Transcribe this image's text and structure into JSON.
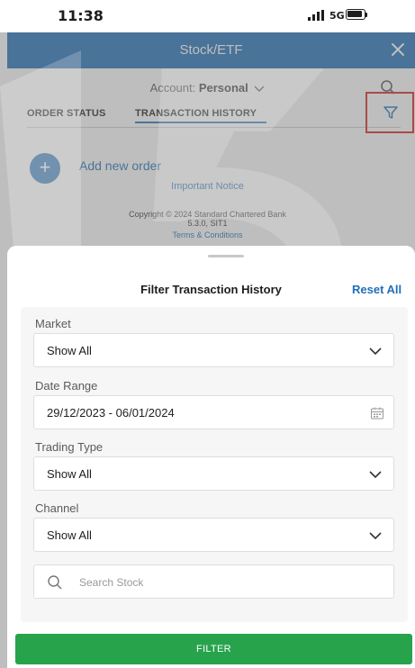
{
  "status_bar": {
    "time": "11:38",
    "network": "5G"
  },
  "header": {
    "title": "Stock/ETF"
  },
  "account": {
    "label": "Account:",
    "value": "Personal"
  },
  "tabs": [
    {
      "label": "ORDER STATUS"
    },
    {
      "label": "TRANSACTION HISTORY"
    }
  ],
  "background": {
    "add_order": "Add new order",
    "notice": "Important Notice",
    "copyright_line1": "Copyright © 2024 Standard Chartered Bank",
    "copyright_line2": "5.3.0, SIT1",
    "terms": "Terms & Conditions",
    "watermark": "15"
  },
  "sheet": {
    "title": "Filter Transaction History",
    "reset_label": "Reset All",
    "market": {
      "label": "Market",
      "value": "Show All"
    },
    "date_range": {
      "label": "Date Range",
      "value": "29/12/2023 - 06/01/2024"
    },
    "trading_type": {
      "label": "Trading Type",
      "value": "Show All"
    },
    "channel": {
      "label": "Channel",
      "value": "Show All"
    },
    "search": {
      "placeholder": "Search Stock"
    },
    "filter_button": "FILTER"
  },
  "colors": {
    "brand_blue": "#1f6fb8",
    "action_green": "#27a34c",
    "highlight_red": "#d9231d"
  },
  "icons": [
    "close-icon",
    "search-icon",
    "filter-icon",
    "plus-icon",
    "chevron-down-icon",
    "calendar-icon"
  ]
}
